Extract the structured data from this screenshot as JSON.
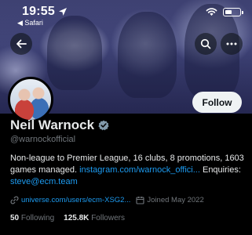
{
  "status_bar": {
    "time": "19:55",
    "back_app": "◀ Safari",
    "icons": [
      "location-arrow-icon",
      "wifi-icon",
      "battery-icon"
    ],
    "battery_level": 0.5
  },
  "header": {
    "back_icon": "arrow-left-icon",
    "search_icon": "search-icon",
    "more_icon": "more-icon"
  },
  "profile": {
    "follow_label": "Follow",
    "name": "Neil Warnock",
    "handle": "@warnockofficial",
    "bio_text": "Non-league to Premier League, 16 clubs, 8 promotions, 1603 games managed. ",
    "bio_link": "instagram.com/warnock_offici...",
    "bio_enquiries": " Enquiries:",
    "bio_email": "steve@ecm.team",
    "website": "universe.com/users/ecm-XSG2...",
    "joined": "Joined May 2022",
    "following_count": "50",
    "following_label": "Following",
    "followers_count": "125.8K",
    "followers_label": "Followers"
  },
  "colors": {
    "accent": "#1d9bf0",
    "background": "#000000",
    "secondary_text": "#71767b",
    "verified_badge": "#829aab"
  }
}
